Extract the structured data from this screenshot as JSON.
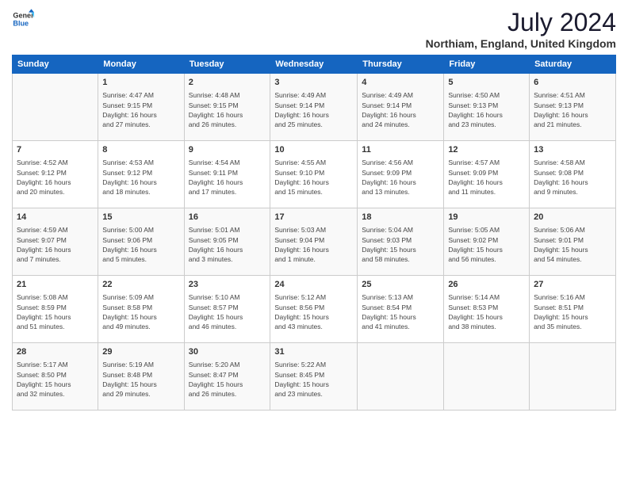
{
  "header": {
    "logo_general": "General",
    "logo_blue": "Blue",
    "title": "July 2024",
    "location": "Northiam, England, United Kingdom"
  },
  "days_of_week": [
    "Sunday",
    "Monday",
    "Tuesday",
    "Wednesday",
    "Thursday",
    "Friday",
    "Saturday"
  ],
  "weeks": [
    [
      {
        "day": "",
        "info": ""
      },
      {
        "day": "1",
        "info": "Sunrise: 4:47 AM\nSunset: 9:15 PM\nDaylight: 16 hours\nand 27 minutes."
      },
      {
        "day": "2",
        "info": "Sunrise: 4:48 AM\nSunset: 9:15 PM\nDaylight: 16 hours\nand 26 minutes."
      },
      {
        "day": "3",
        "info": "Sunrise: 4:49 AM\nSunset: 9:14 PM\nDaylight: 16 hours\nand 25 minutes."
      },
      {
        "day": "4",
        "info": "Sunrise: 4:49 AM\nSunset: 9:14 PM\nDaylight: 16 hours\nand 24 minutes."
      },
      {
        "day": "5",
        "info": "Sunrise: 4:50 AM\nSunset: 9:13 PM\nDaylight: 16 hours\nand 23 minutes."
      },
      {
        "day": "6",
        "info": "Sunrise: 4:51 AM\nSunset: 9:13 PM\nDaylight: 16 hours\nand 21 minutes."
      }
    ],
    [
      {
        "day": "7",
        "info": "Sunrise: 4:52 AM\nSunset: 9:12 PM\nDaylight: 16 hours\nand 20 minutes."
      },
      {
        "day": "8",
        "info": "Sunrise: 4:53 AM\nSunset: 9:12 PM\nDaylight: 16 hours\nand 18 minutes."
      },
      {
        "day": "9",
        "info": "Sunrise: 4:54 AM\nSunset: 9:11 PM\nDaylight: 16 hours\nand 17 minutes."
      },
      {
        "day": "10",
        "info": "Sunrise: 4:55 AM\nSunset: 9:10 PM\nDaylight: 16 hours\nand 15 minutes."
      },
      {
        "day": "11",
        "info": "Sunrise: 4:56 AM\nSunset: 9:09 PM\nDaylight: 16 hours\nand 13 minutes."
      },
      {
        "day": "12",
        "info": "Sunrise: 4:57 AM\nSunset: 9:09 PM\nDaylight: 16 hours\nand 11 minutes."
      },
      {
        "day": "13",
        "info": "Sunrise: 4:58 AM\nSunset: 9:08 PM\nDaylight: 16 hours\nand 9 minutes."
      }
    ],
    [
      {
        "day": "14",
        "info": "Sunrise: 4:59 AM\nSunset: 9:07 PM\nDaylight: 16 hours\nand 7 minutes."
      },
      {
        "day": "15",
        "info": "Sunrise: 5:00 AM\nSunset: 9:06 PM\nDaylight: 16 hours\nand 5 minutes."
      },
      {
        "day": "16",
        "info": "Sunrise: 5:01 AM\nSunset: 9:05 PM\nDaylight: 16 hours\nand 3 minutes."
      },
      {
        "day": "17",
        "info": "Sunrise: 5:03 AM\nSunset: 9:04 PM\nDaylight: 16 hours\nand 1 minute."
      },
      {
        "day": "18",
        "info": "Sunrise: 5:04 AM\nSunset: 9:03 PM\nDaylight: 15 hours\nand 58 minutes."
      },
      {
        "day": "19",
        "info": "Sunrise: 5:05 AM\nSunset: 9:02 PM\nDaylight: 15 hours\nand 56 minutes."
      },
      {
        "day": "20",
        "info": "Sunrise: 5:06 AM\nSunset: 9:01 PM\nDaylight: 15 hours\nand 54 minutes."
      }
    ],
    [
      {
        "day": "21",
        "info": "Sunrise: 5:08 AM\nSunset: 8:59 PM\nDaylight: 15 hours\nand 51 minutes."
      },
      {
        "day": "22",
        "info": "Sunrise: 5:09 AM\nSunset: 8:58 PM\nDaylight: 15 hours\nand 49 minutes."
      },
      {
        "day": "23",
        "info": "Sunrise: 5:10 AM\nSunset: 8:57 PM\nDaylight: 15 hours\nand 46 minutes."
      },
      {
        "day": "24",
        "info": "Sunrise: 5:12 AM\nSunset: 8:56 PM\nDaylight: 15 hours\nand 43 minutes."
      },
      {
        "day": "25",
        "info": "Sunrise: 5:13 AM\nSunset: 8:54 PM\nDaylight: 15 hours\nand 41 minutes."
      },
      {
        "day": "26",
        "info": "Sunrise: 5:14 AM\nSunset: 8:53 PM\nDaylight: 15 hours\nand 38 minutes."
      },
      {
        "day": "27",
        "info": "Sunrise: 5:16 AM\nSunset: 8:51 PM\nDaylight: 15 hours\nand 35 minutes."
      }
    ],
    [
      {
        "day": "28",
        "info": "Sunrise: 5:17 AM\nSunset: 8:50 PM\nDaylight: 15 hours\nand 32 minutes."
      },
      {
        "day": "29",
        "info": "Sunrise: 5:19 AM\nSunset: 8:48 PM\nDaylight: 15 hours\nand 29 minutes."
      },
      {
        "day": "30",
        "info": "Sunrise: 5:20 AM\nSunset: 8:47 PM\nDaylight: 15 hours\nand 26 minutes."
      },
      {
        "day": "31",
        "info": "Sunrise: 5:22 AM\nSunset: 8:45 PM\nDaylight: 15 hours\nand 23 minutes."
      },
      {
        "day": "",
        "info": ""
      },
      {
        "day": "",
        "info": ""
      },
      {
        "day": "",
        "info": ""
      }
    ]
  ]
}
